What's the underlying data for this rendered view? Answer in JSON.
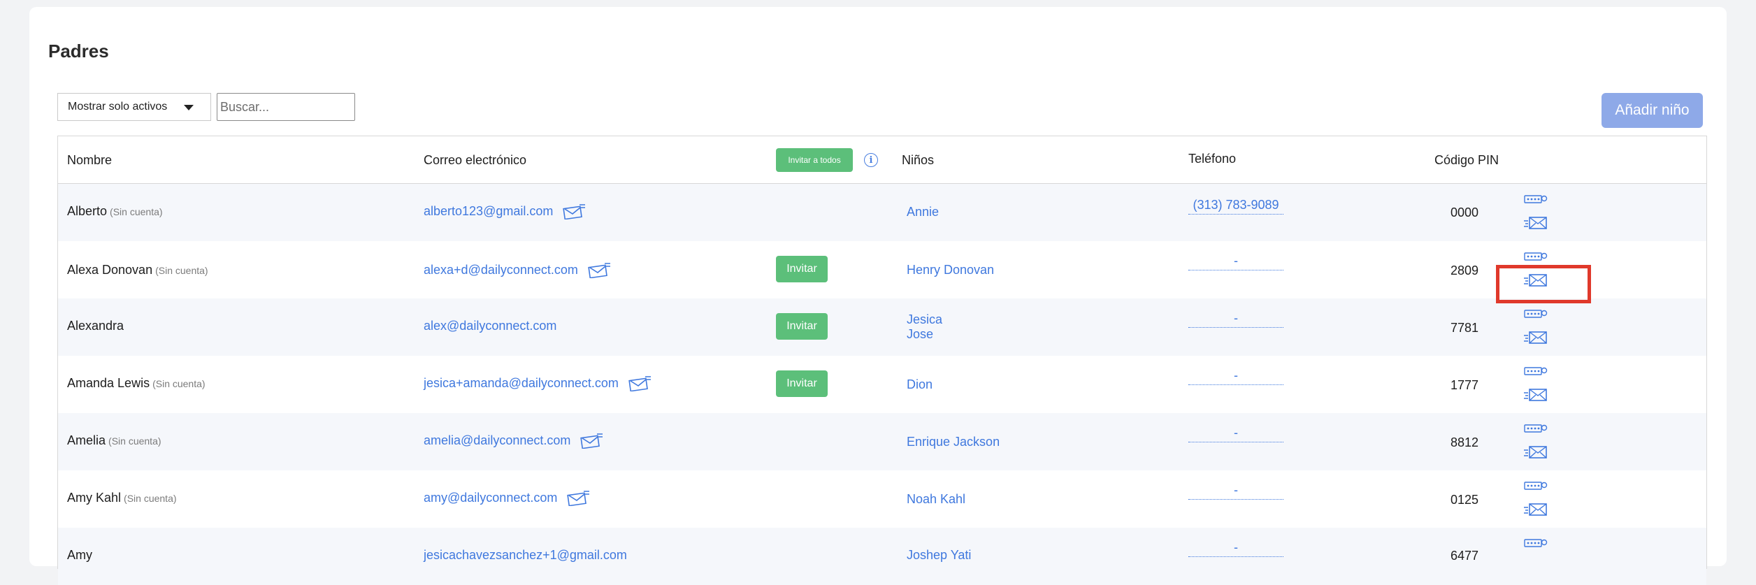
{
  "page": {
    "title": "Padres"
  },
  "toolbar": {
    "filter_selected": "Mostrar solo activos",
    "search_placeholder": "Buscar...",
    "add_child_label": "Añadir niño"
  },
  "table": {
    "headers": {
      "name": "Nombre",
      "email": "Correo electrónico",
      "invite_all": "Invitar a todos",
      "children": "Niños",
      "phone": "Teléfono",
      "pin": "Código PIN"
    },
    "no_account_label": "(Sin cuenta)",
    "invite_label": "Invitar",
    "rows": [
      {
        "name": "Alberto",
        "no_account": "(Sin cuenta)",
        "email": "alberto123@gmail.com",
        "children": [
          "Annie"
        ],
        "phone": "(313) 783-9089",
        "pin": "0000"
      },
      {
        "name": "Alexa Donovan",
        "no_account": "(Sin cuenta)",
        "email": "alexa+d@dailyconnect.com",
        "invite": "Invitar",
        "children": [
          "Henry Donovan"
        ],
        "phone": "-",
        "pin": "2809"
      },
      {
        "name": "Alexandra",
        "email": "alex@dailyconnect.com",
        "invite": "Invitar",
        "children": [
          "Jesica",
          "Jose"
        ],
        "phone": "-",
        "pin": "7781"
      },
      {
        "name": "Amanda Lewis",
        "no_account": "(Sin cuenta)",
        "email": "jesica+amanda@dailyconnect.com",
        "invite": "Invitar",
        "children": [
          "Dion"
        ],
        "phone": "-",
        "pin": "1777"
      },
      {
        "name": "Amelia",
        "no_account": "(Sin cuenta)",
        "email": "amelia@dailyconnect.com",
        "children": [
          "Enrique Jackson"
        ],
        "phone": "-",
        "pin": "8812"
      },
      {
        "name": "Amy Kahl",
        "no_account": "(Sin cuenta)",
        "email": "amy@dailyconnect.com",
        "children": [
          "Noah Kahl"
        ],
        "phone": "-",
        "pin": "0125"
      },
      {
        "name": "Amy",
        "email": "jesicachavezsanchez+1@gmail.com",
        "children": [
          "Joshep Yati"
        ],
        "phone": "-",
        "pin": "6477"
      }
    ]
  },
  "colors": {
    "link": "#3f78de",
    "invite_green": "#5cbf7a",
    "add_button": "#8ea9e8",
    "highlight": "#e0392b"
  },
  "icons": {
    "filter_caret": "chevron-down-icon",
    "info": "info-icon",
    "email_edit": "mail-edit-icon",
    "pin": "pin-icon",
    "send_pin": "send-pin-icon"
  }
}
